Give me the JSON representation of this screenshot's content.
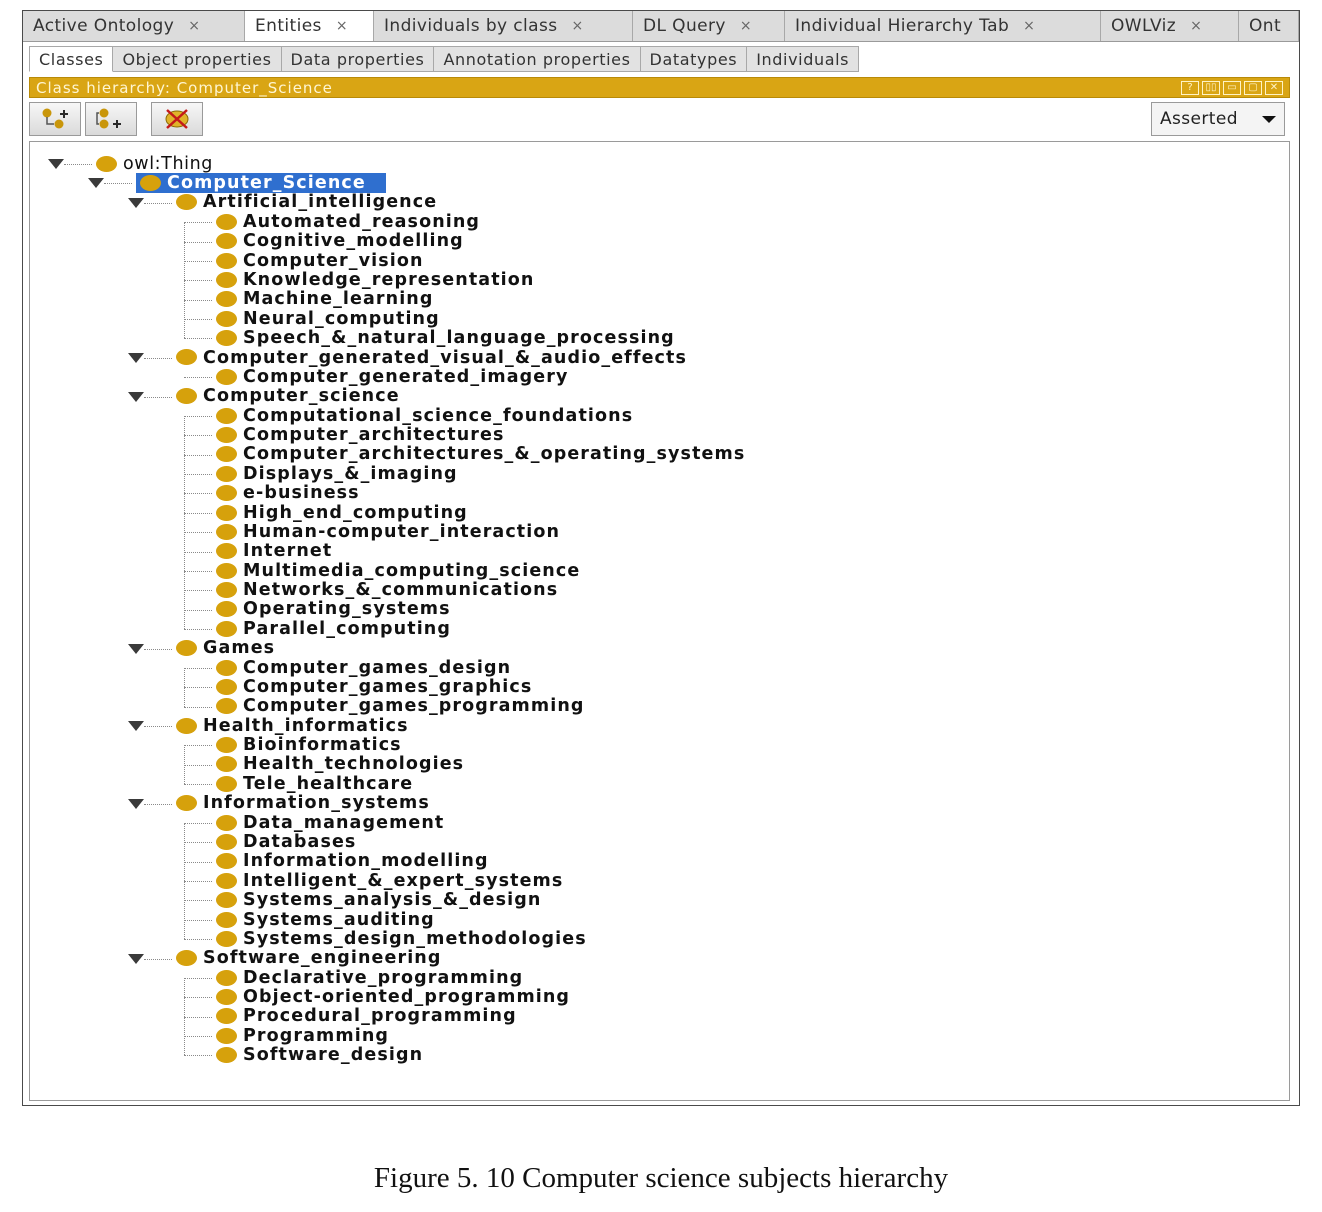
{
  "top_tabs": [
    {
      "label": "Active Ontology",
      "close": "×"
    },
    {
      "label": "Entities",
      "close": "×"
    },
    {
      "label": "Individuals by class",
      "close": "×"
    },
    {
      "label": "DL Query",
      "close": "×"
    },
    {
      "label": "Individual Hierarchy Tab",
      "close": "×"
    },
    {
      "label": "OWLViz",
      "close": "×"
    },
    {
      "label": "Ont",
      "close": ""
    }
  ],
  "active_top_tab": "Entities",
  "sub_tabs": [
    "Classes",
    "Object properties",
    "Data properties",
    "Annotation properties",
    "Datatypes",
    "Individuals"
  ],
  "active_sub_tab": "Classes",
  "view": {
    "title": "Class hierarchy: Computer_Science",
    "controls": [
      "?",
      "▯▯",
      "▭",
      "▢",
      "✕"
    ]
  },
  "toolbar": {
    "icons": [
      "add-subclass-icon",
      "add-sibling-class-icon",
      "delete-class-icon"
    ]
  },
  "asserted_select": {
    "value": "Asserted"
  },
  "tree": {
    "root": "owl:Thing",
    "selected": "Computer_Science",
    "groups": [
      {
        "label": "Artificial_intelligence",
        "children": [
          "Automated_reasoning",
          "Cognitive_modelling",
          "Computer_vision",
          "Knowledge_representation",
          "Machine_learning",
          "Neural_computing",
          "Speech_&_natural_language_processing"
        ]
      },
      {
        "label": "Computer_generated_visual_&_audio_effects",
        "children": [
          "Computer_generated_imagery"
        ]
      },
      {
        "label": "Computer_science",
        "children": [
          "Computational_science_foundations",
          "Computer_architectures",
          "Computer_architectures_&_operating_systems",
          "Displays_&_imaging",
          "e-business",
          "High_end_computing",
          "Human-computer_interaction",
          "Internet",
          "Multimedia_computing_science",
          "Networks_&_communications",
          "Operating_systems",
          "Parallel_computing"
        ]
      },
      {
        "label": "Games",
        "children": [
          "Computer_games_design",
          "Computer_games_graphics",
          "Computer_games_programming"
        ]
      },
      {
        "label": "Health_informatics",
        "children": [
          "Bioinformatics",
          "Health_technologies",
          "Tele_healthcare"
        ]
      },
      {
        "label": "Information_systems",
        "children": [
          "Data_management",
          "Databases",
          "Information_modelling",
          "Intelligent_&_expert_systems",
          "Systems_analysis_&_design",
          "Systems_auditing",
          "Systems_design_methodologies"
        ]
      },
      {
        "label": "Software_engineering",
        "children": [
          "Declarative_programming",
          "Object-oriented_programming",
          "Procedural_programming",
          "Programming",
          "Software_design"
        ]
      }
    ]
  },
  "caption": "Figure 5. 10 Computer science subjects hierarchy",
  "colors": {
    "class_dot": "#d6a10c",
    "view_bar": "#d9a514",
    "selection": "#2f6fcf"
  }
}
